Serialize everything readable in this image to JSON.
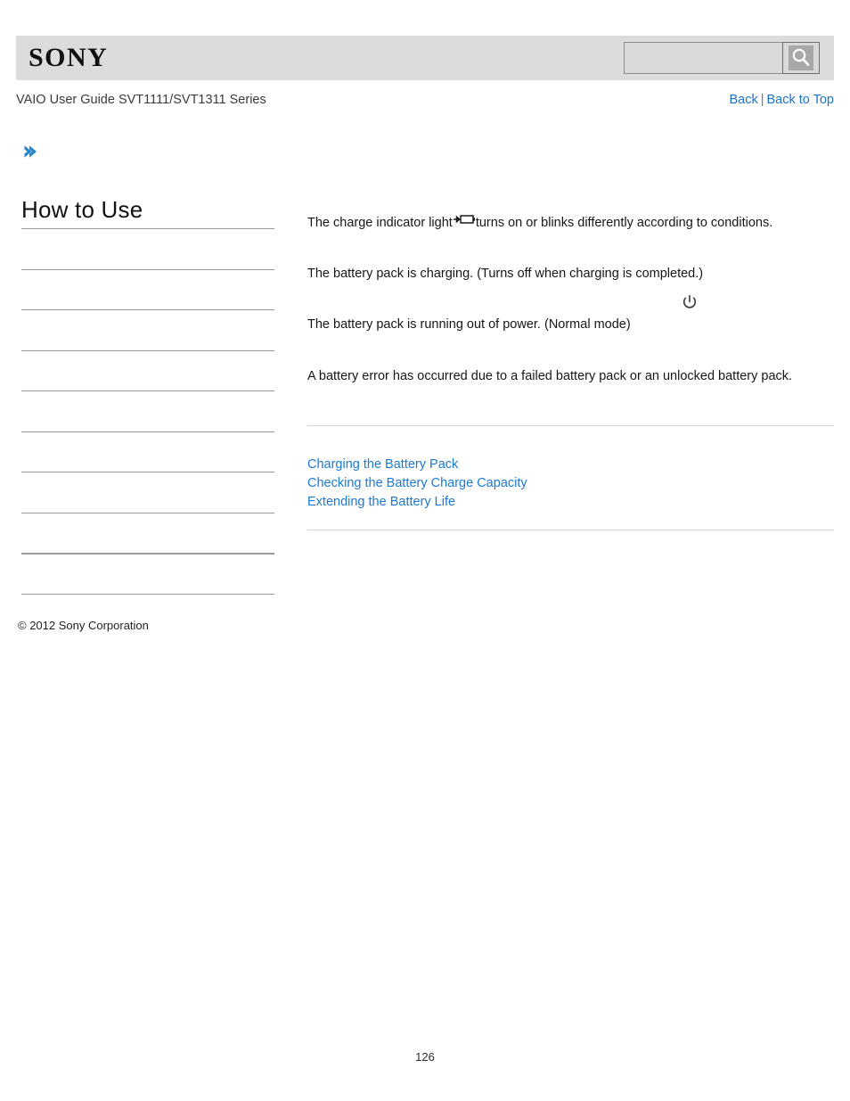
{
  "header": {
    "logo_text": "SONY",
    "search": {
      "value": "",
      "placeholder": "",
      "icon": "search-icon"
    }
  },
  "subheader": {
    "guide_title": "VAIO User Guide SVT1111/SVT1311 Series",
    "back_label": "Back",
    "separator": "|",
    "back_to_top_label": "Back to Top"
  },
  "sidebar": {
    "breadcrumb_icon": "chevron-right-icon",
    "title": "How to Use",
    "items": [
      {
        "label": ""
      },
      {
        "label": ""
      },
      {
        "label": ""
      },
      {
        "label": ""
      },
      {
        "label": ""
      },
      {
        "label": ""
      },
      {
        "label": ""
      },
      {
        "label": ""
      },
      {
        "label": ""
      },
      {
        "label": ""
      }
    ],
    "copyright": "© 2012 Sony Corporation"
  },
  "content": {
    "intro_prefix": "The charge indicator light",
    "intro_icon": "charge-indicator-icon",
    "intro_suffix": "turns on or blinks differently according to conditions.",
    "charging_text": "The battery pack is charging. (Turns off when charging is completed.)",
    "power_icon": "power-icon",
    "low_power_text": "The battery pack is running out of power. (Normal mode)",
    "error_text": "A battery error has occurred due to a failed battery pack or an unlocked battery pack.",
    "related_links": [
      "Charging the Battery Pack",
      "Checking the Battery Charge Capacity",
      "Extending the Battery Life"
    ]
  },
  "footer": {
    "page_number": "126"
  },
  "colors": {
    "header_band": "#dcdcdc",
    "link_blue": "#1a7ad4",
    "nav_link_blue": "#1a73c8",
    "divider_gray": "#9a9a9a",
    "rule_gray": "#d2d2d2"
  }
}
